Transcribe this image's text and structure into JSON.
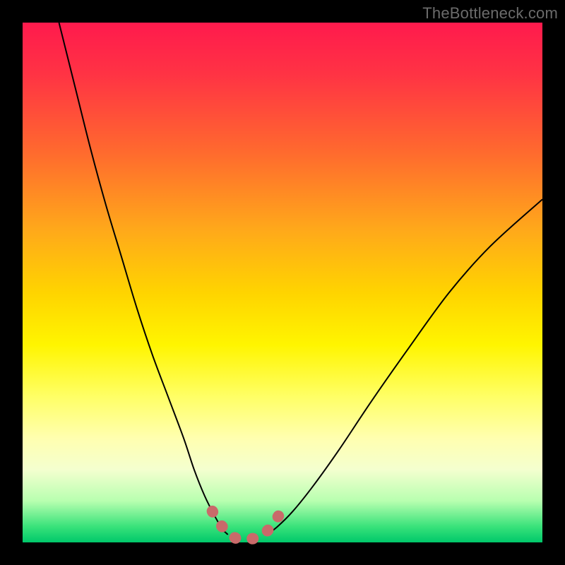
{
  "watermark": "TheBottleneck.com",
  "chart_data": {
    "type": "line",
    "title": "",
    "xlabel": "",
    "ylabel": "",
    "xlim": [
      0,
      100
    ],
    "ylim": [
      0,
      100
    ],
    "grid": false,
    "legend": false,
    "series": [
      {
        "name": "left-curve",
        "color": "#000000",
        "x": [
          7,
          10,
          13,
          16,
          19,
          22,
          25,
          28,
          31,
          33,
          35,
          37,
          38.5,
          39.5
        ],
        "values": [
          100,
          88,
          76,
          65,
          55,
          45,
          36,
          28,
          20,
          14,
          9,
          5,
          2.5,
          1.5
        ]
      },
      {
        "name": "right-curve",
        "color": "#000000",
        "x": [
          47,
          49,
          52,
          56,
          61,
          67,
          74,
          82,
          90,
          100
        ],
        "values": [
          1.5,
          3,
          6,
          11,
          18,
          27,
          37,
          48,
          57,
          66
        ]
      },
      {
        "name": "minimum-marker",
        "color": "#c96a6a",
        "x": [
          36.5,
          38,
          39.5,
          41,
          43,
          45,
          46.5,
          48,
          49.5
        ],
        "values": [
          6,
          3.5,
          1.8,
          0.8,
          0.6,
          0.8,
          1.6,
          3.2,
          5.5
        ]
      }
    ],
    "annotations": []
  }
}
